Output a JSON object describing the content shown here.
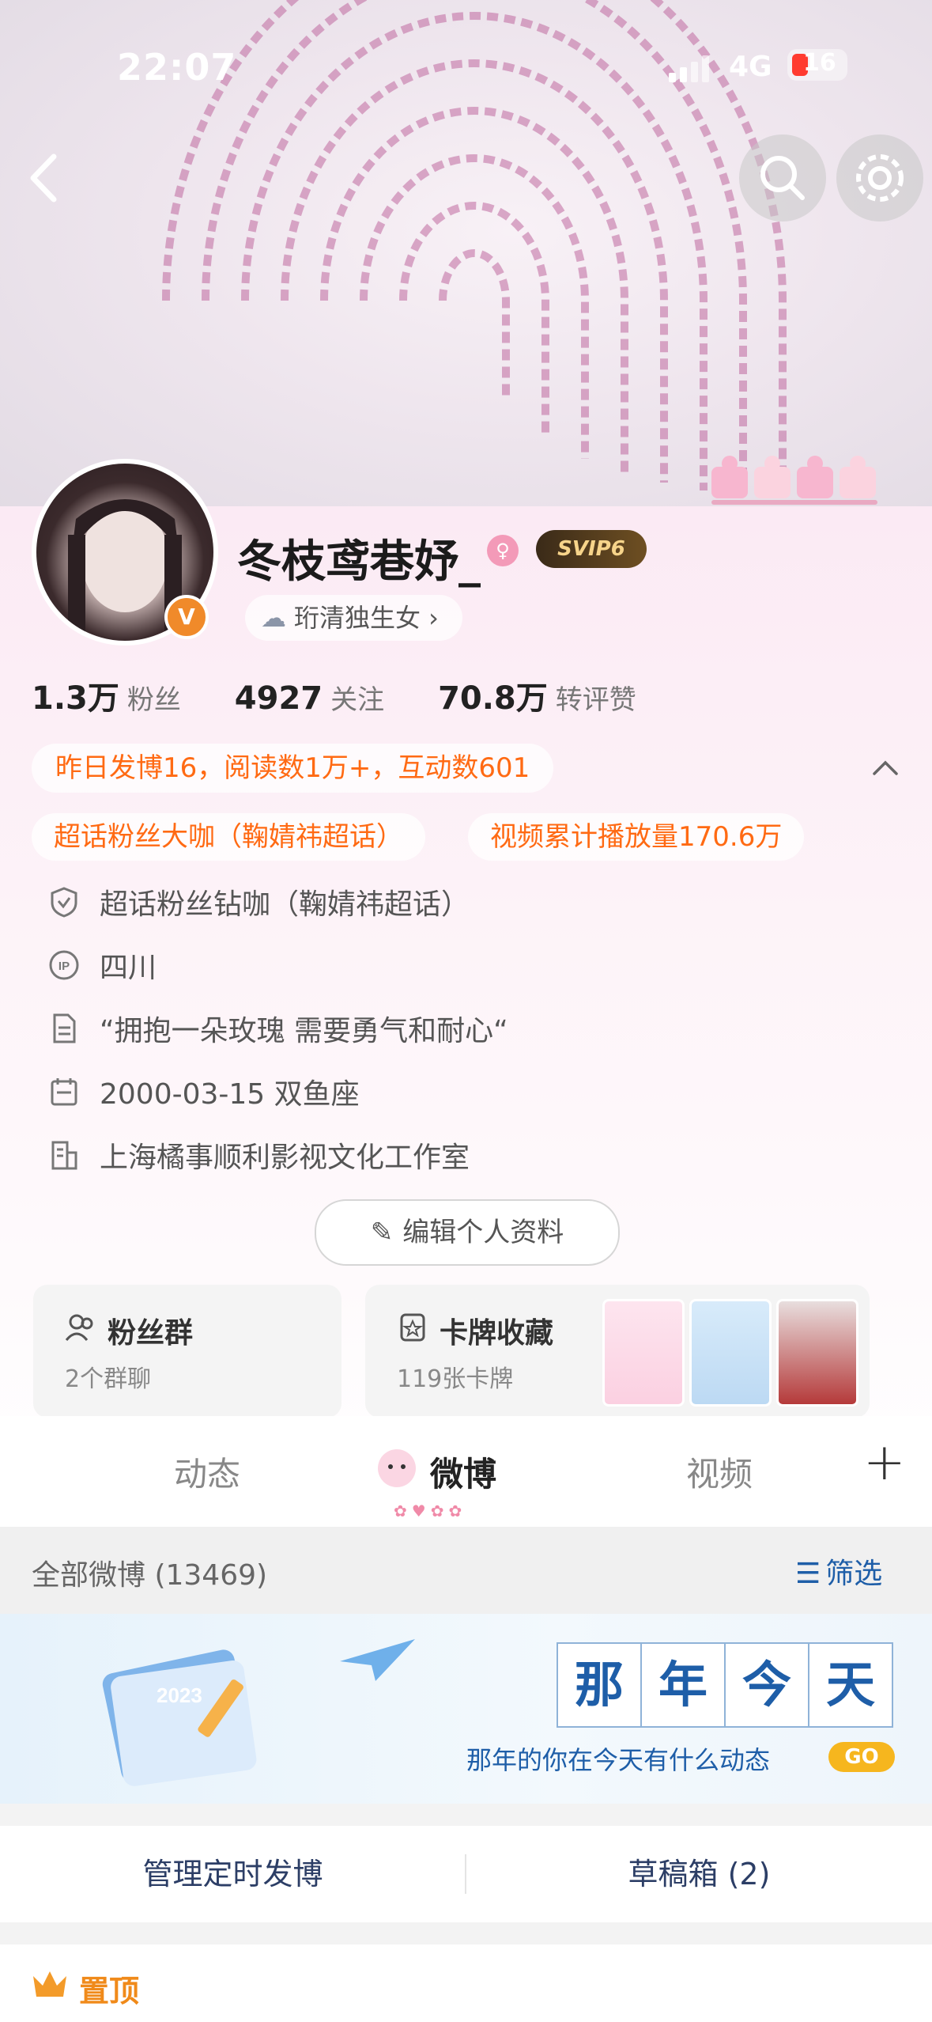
{
  "status_bar": {
    "time": "22:07",
    "network": "4G",
    "battery": "16"
  },
  "profile": {
    "nickname": "冬枝鸢巷妤_",
    "vip_label": "SVIP6",
    "verified_badge": "V",
    "tag": "珩清独生女 ›",
    "stats": [
      {
        "value": "1.3万",
        "label": "粉丝"
      },
      {
        "value": "4927",
        "label": "关注"
      },
      {
        "value": "70.8万",
        "label": "转评赞"
      }
    ],
    "yesterday": "昨日发博16，阅读数1万+，互动数601",
    "badges": [
      "超话粉丝大咖（鞠婧祎超话）",
      "视频累计播放量170.6万"
    ],
    "info": [
      {
        "icon": "shield-icon",
        "text": "超话粉丝钻咖（鞠婧祎超话）"
      },
      {
        "icon": "ip-icon",
        "text": "四川"
      },
      {
        "icon": "document-icon",
        "text": "“拥抱一朵玫瑰 需要勇气和耐心“"
      },
      {
        "icon": "calendar-icon",
        "text": "2000-03-15 双鱼座"
      },
      {
        "icon": "building-icon",
        "text": "上海橘事顺利影视文化工作室"
      }
    ],
    "edit_label": "编辑个人资料"
  },
  "cards": {
    "fans": {
      "title": "粉丝群",
      "subtitle": "2个群聊"
    },
    "collection": {
      "title": "卡牌收藏",
      "subtitle": "119张卡牌"
    }
  },
  "tabs": {
    "items": [
      "动态",
      "微博",
      "视频"
    ],
    "active": "微博",
    "add": "+"
  },
  "feed": {
    "filter_label": "全部微博 (13469)",
    "filter_button": "筛选",
    "banner_title": [
      "那",
      "年",
      "今",
      "天"
    ],
    "banner_sub": "那年的你在今天有什么动态",
    "banner_go": "GO",
    "manage_scheduled": "管理定时发博",
    "drafts": "草稿箱 (2)",
    "pinned": "置顶"
  },
  "colors": {
    "accent": "#ff6a13",
    "vip_gold": "#f7d48a",
    "link_blue": "#1e5ea8"
  }
}
